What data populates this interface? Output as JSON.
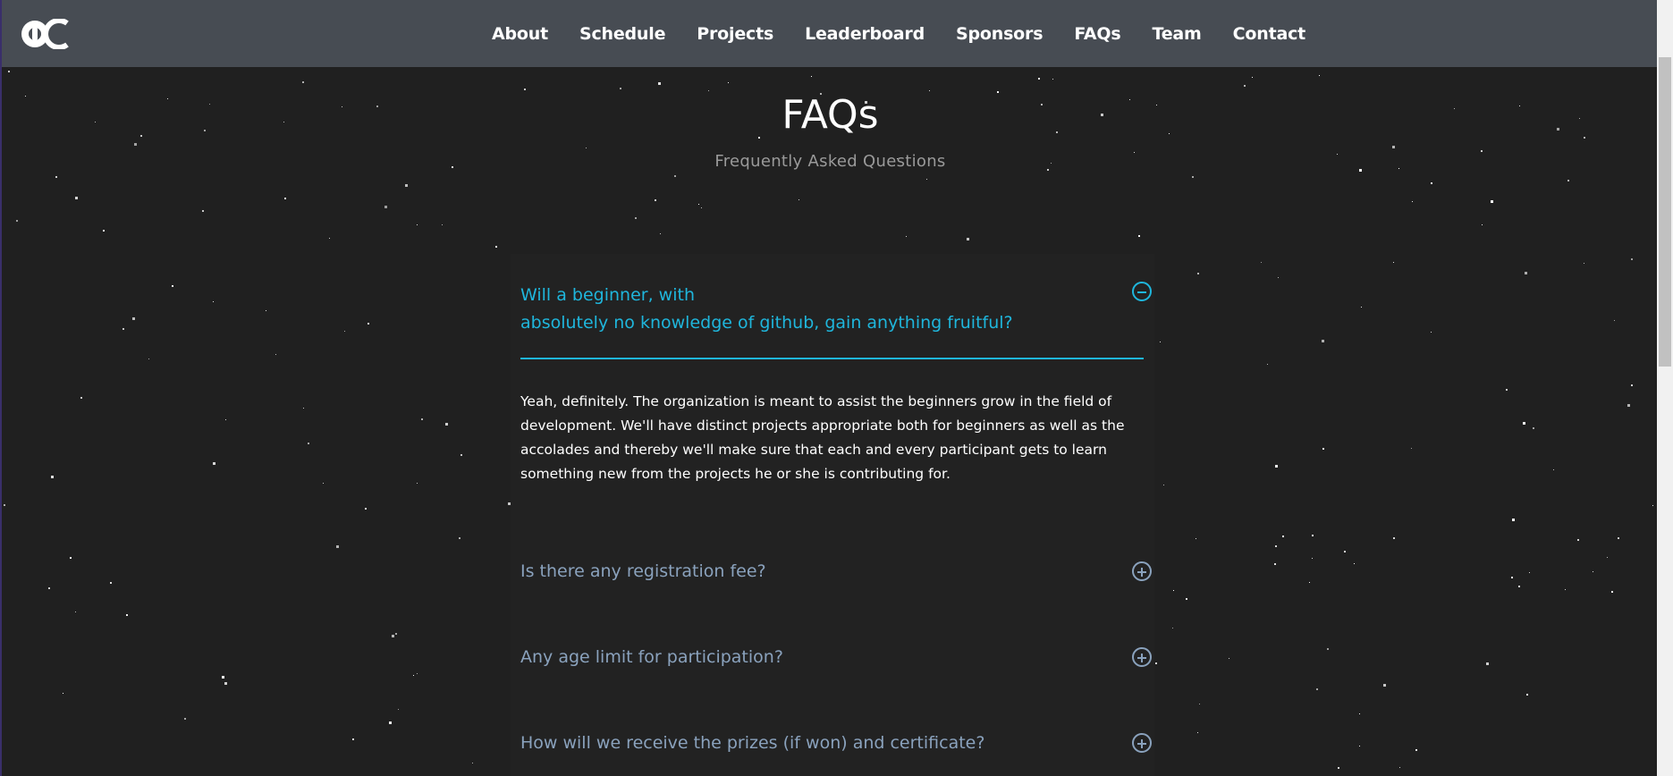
{
  "nav": {
    "logo_alt": "OC",
    "links": [
      "About",
      "Schedule",
      "Projects",
      "Leaderboard",
      "Sponsors",
      "FAQs",
      "Team",
      "Contact"
    ]
  },
  "header": {
    "title": "FAQs",
    "subtitle": "Frequently Asked Questions"
  },
  "faq": {
    "items": [
      {
        "question_line1": "Will a beginner, with",
        "question_line2": "absolutely no knowledge of github, gain anything fruitful?",
        "answer": "Yeah, definitely. The organization is meant to assist the beginners grow in the field of development. We'll have distinct projects appropriate both for beginners as well as the accolades and thereby we'll make sure that each and every participant gets to learn something new from the projects he or she is contributing for.",
        "state": "expanded"
      },
      {
        "question": "Is there any registration fee?",
        "state": "collapsed"
      },
      {
        "question": "Any age limit for participation?",
        "state": "collapsed"
      },
      {
        "question": "How will we receive the prizes (if won) and certificate?",
        "state": "collapsed"
      }
    ]
  },
  "colors": {
    "accent": "#1fb6dc",
    "collapsed_text": "#8aa2bd",
    "navbar_bg": "#474c53",
    "page_bg": "#202020"
  }
}
